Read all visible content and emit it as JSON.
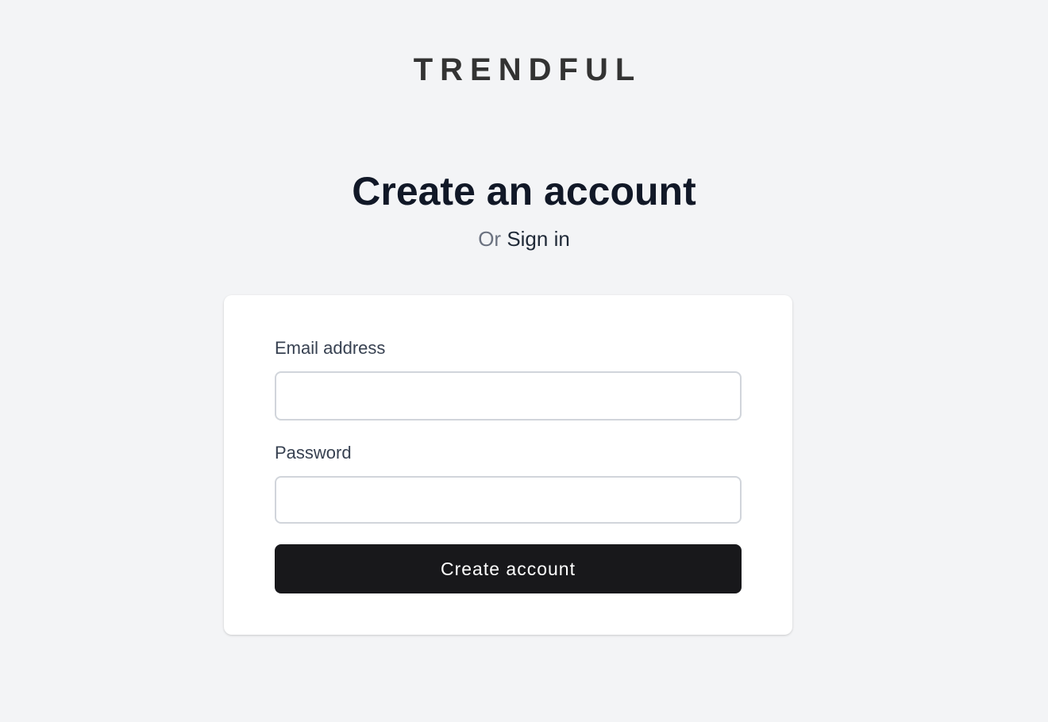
{
  "brand": {
    "logo_text": "TRENDFUL"
  },
  "header": {
    "title": "Create an account",
    "or_text": "Or",
    "sign_in_label": "Sign in"
  },
  "form": {
    "email_label": "Email address",
    "email_value": "",
    "email_placeholder": "",
    "password_label": "Password",
    "password_value": "",
    "password_placeholder": "",
    "submit_label": "Create account"
  },
  "colors": {
    "background": "#f3f4f6",
    "card": "#ffffff",
    "button": "#18181b",
    "title": "#111827",
    "muted": "#6b7280"
  }
}
